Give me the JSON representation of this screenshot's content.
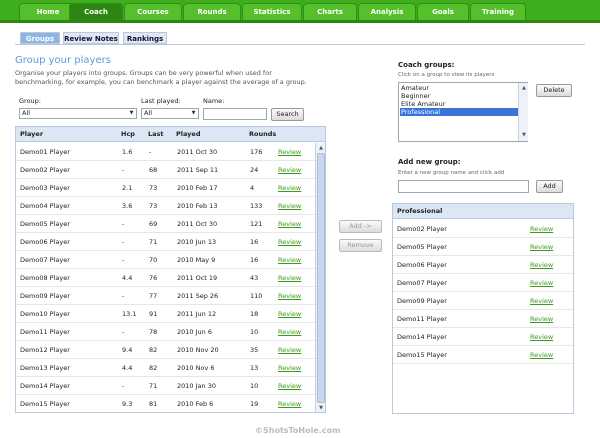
{
  "nav": {
    "tabs": [
      {
        "label": "Home"
      },
      {
        "label": "Coach"
      },
      {
        "label": "Courses"
      },
      {
        "label": "Rounds"
      },
      {
        "label": "Statistics"
      },
      {
        "label": "Charts"
      },
      {
        "label": "Analysis"
      },
      {
        "label": "Goals"
      },
      {
        "label": "Training"
      }
    ],
    "active": "Coach"
  },
  "subtabs": [
    {
      "label": "Groups"
    },
    {
      "label": "Review Notes"
    },
    {
      "label": "Rankings"
    }
  ],
  "page": {
    "title": "Group your players",
    "description": "Organise your players into groups. Groups can be very powerful when used for benchmarking, for example, you can benchmark a player against the average of a group."
  },
  "filters": {
    "group_label": "Group:",
    "group_value": "All",
    "last_played_label": "Last played:",
    "last_played_value": "All",
    "name_label": "Name:",
    "name_value": "",
    "search_label": "Search"
  },
  "players_table": {
    "headers": {
      "player": "Player",
      "hcp": "Hcp",
      "last": "Last",
      "played": "Played",
      "rounds": "Rounds"
    },
    "rows": [
      {
        "player": "Demo01 Player",
        "hcp": "1.6",
        "last": "-",
        "played": "2011 Oct 30",
        "rounds": "176",
        "action": "Review"
      },
      {
        "player": "Demo02 Player",
        "hcp": "-",
        "last": "68",
        "played": "2011 Sep 11",
        "rounds": "24",
        "action": "Review"
      },
      {
        "player": "Demo03 Player",
        "hcp": "2.1",
        "last": "73",
        "played": "2010 Feb 17",
        "rounds": "4",
        "action": "Review"
      },
      {
        "player": "Demo04 Player",
        "hcp": "3.6",
        "last": "73",
        "played": "2010 Feb 13",
        "rounds": "133",
        "action": "Review"
      },
      {
        "player": "Demo05 Player",
        "hcp": "-",
        "last": "69",
        "played": "2011 Oct 30",
        "rounds": "121",
        "action": "Review"
      },
      {
        "player": "Demo06 Player",
        "hcp": "-",
        "last": "71",
        "played": "2010 Jun 13",
        "rounds": "16",
        "action": "Review"
      },
      {
        "player": "Demo07 Player",
        "hcp": "-",
        "last": "70",
        "played": "2010 May 9",
        "rounds": "16",
        "action": "Review"
      },
      {
        "player": "Demo08 Player",
        "hcp": "4.4",
        "last": "76",
        "played": "2011 Oct 19",
        "rounds": "43",
        "action": "Review"
      },
      {
        "player": "Demo09 Player",
        "hcp": "-",
        "last": "77",
        "played": "2011 Sep 26",
        "rounds": "110",
        "action": "Review"
      },
      {
        "player": "Demo10 Player",
        "hcp": "13.1",
        "last": "91",
        "played": "2011 Jun 12",
        "rounds": "18",
        "action": "Review"
      },
      {
        "player": "Demo11 Player",
        "hcp": "-",
        "last": "78",
        "played": "2010 Jun 6",
        "rounds": "10",
        "action": "Review"
      },
      {
        "player": "Demo12 Player",
        "hcp": "9.4",
        "last": "82",
        "played": "2010 Nov 20",
        "rounds": "35",
        "action": "Review"
      },
      {
        "player": "Demo13 Player",
        "hcp": "4.4",
        "last": "82",
        "played": "2010 Nov 6",
        "rounds": "13",
        "action": "Review"
      },
      {
        "player": "Demo14 Player",
        "hcp": "-",
        "last": "71",
        "played": "2010 Jan 30",
        "rounds": "10",
        "action": "Review"
      },
      {
        "player": "Demo15 Player",
        "hcp": "9.3",
        "last": "81",
        "played": "2010 Feb 6",
        "rounds": "19",
        "action": "Review"
      }
    ]
  },
  "middle_buttons": {
    "add": "Add ->",
    "remove": "Remove"
  },
  "coach_groups": {
    "title": "Coach groups:",
    "hint": "Click on a group to view its players",
    "items": [
      "Amateur",
      "Beginner",
      "Elite Amateur",
      "Professional"
    ],
    "selected": "Professional",
    "delete_label": "Delete"
  },
  "new_group": {
    "title": "Add new group:",
    "hint": "Enter a new group name and click add",
    "value": "",
    "add_label": "Add"
  },
  "group_table": {
    "header": "Professional",
    "rows": [
      {
        "player": "Demo02 Player",
        "action": "Review"
      },
      {
        "player": "Demo05 Player",
        "action": "Review"
      },
      {
        "player": "Demo06 Player",
        "action": "Review"
      },
      {
        "player": "Demo07 Player",
        "action": "Review"
      },
      {
        "player": "Demo09 Player",
        "action": "Review"
      },
      {
        "player": "Demo11 Player",
        "action": "Review"
      },
      {
        "player": "Demo14 Player",
        "action": "Review"
      },
      {
        "player": "Demo15 Player",
        "action": "Review"
      }
    ]
  },
  "watermark": "©ShotsToHole.com"
}
